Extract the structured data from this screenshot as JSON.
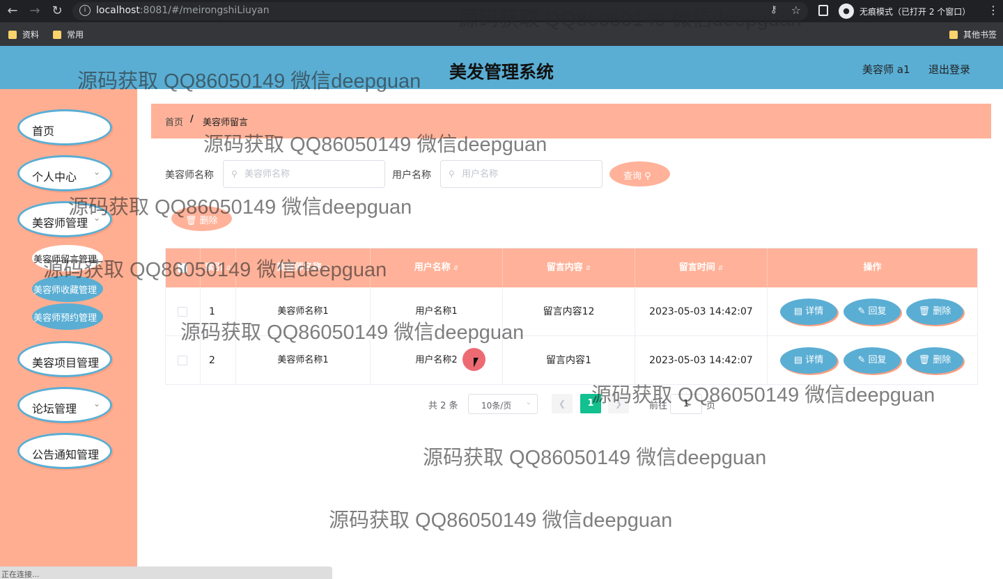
{
  "browser": {
    "url_host": "localhost",
    "url_rest": ":8081/#/meirongshiLiuyan",
    "incognito_label": "无痕模式（已打开 2 个窗口）",
    "bookmarks": [
      "资料",
      "常用"
    ],
    "other_bookmarks": "其他书签",
    "status_text": "正在连接..."
  },
  "header": {
    "title": "美发管理系统",
    "user": "美容师 a1",
    "logout": "退出登录"
  },
  "sidebar": {
    "items": [
      {
        "label": "首页"
      },
      {
        "label": "个人中心"
      },
      {
        "label": "美容师管理"
      },
      {
        "label": "美容项目管理"
      },
      {
        "label": "论坛管理"
      },
      {
        "label": "公告通知管理"
      }
    ],
    "subitems": [
      {
        "label": "美容师留言管理"
      },
      {
        "label": "美容师收藏管理"
      },
      {
        "label": "美容师预约管理"
      }
    ]
  },
  "breadcrumb": {
    "home": "首页",
    "separator": "/",
    "current": "美容师留言"
  },
  "search": {
    "beautician_label": "美容师名称",
    "beautician_placeholder": "美容师名称",
    "user_label": "用户名称",
    "user_placeholder": "用户名称",
    "query_label": "查询",
    "delete_label": "删除"
  },
  "table": {
    "headers": [
      "索引",
      "美容师名称",
      "用户名称",
      "留言内容",
      "留言时间",
      "操作"
    ],
    "rows": [
      {
        "index": "1",
        "beautician": "美容师名称1",
        "user": "用户名称1",
        "content": "留言内容12",
        "time": "2023-05-03 14:42:07"
      },
      {
        "index": "2",
        "beautician": "美容师名称1",
        "user": "用户名称2",
        "content": "留言内容1",
        "time": "2023-05-03 14:42:07"
      }
    ],
    "actions": {
      "detail": "详情",
      "reply": "回复",
      "delete": "删除"
    }
  },
  "pagination": {
    "total": "共 2 条",
    "page_size": "10条/页",
    "current_page": "1",
    "goto_label": "前往",
    "goto_value": "1",
    "page_label": "页"
  },
  "watermark": {
    "text": "源码获取 QQ86050149 微信deepguan"
  },
  "colors": {
    "header_blue": "#5aaed4",
    "sidebar_salmon": "#ffae92",
    "accent_salmon": "#ffb299",
    "pager_green": "#13c08f"
  }
}
